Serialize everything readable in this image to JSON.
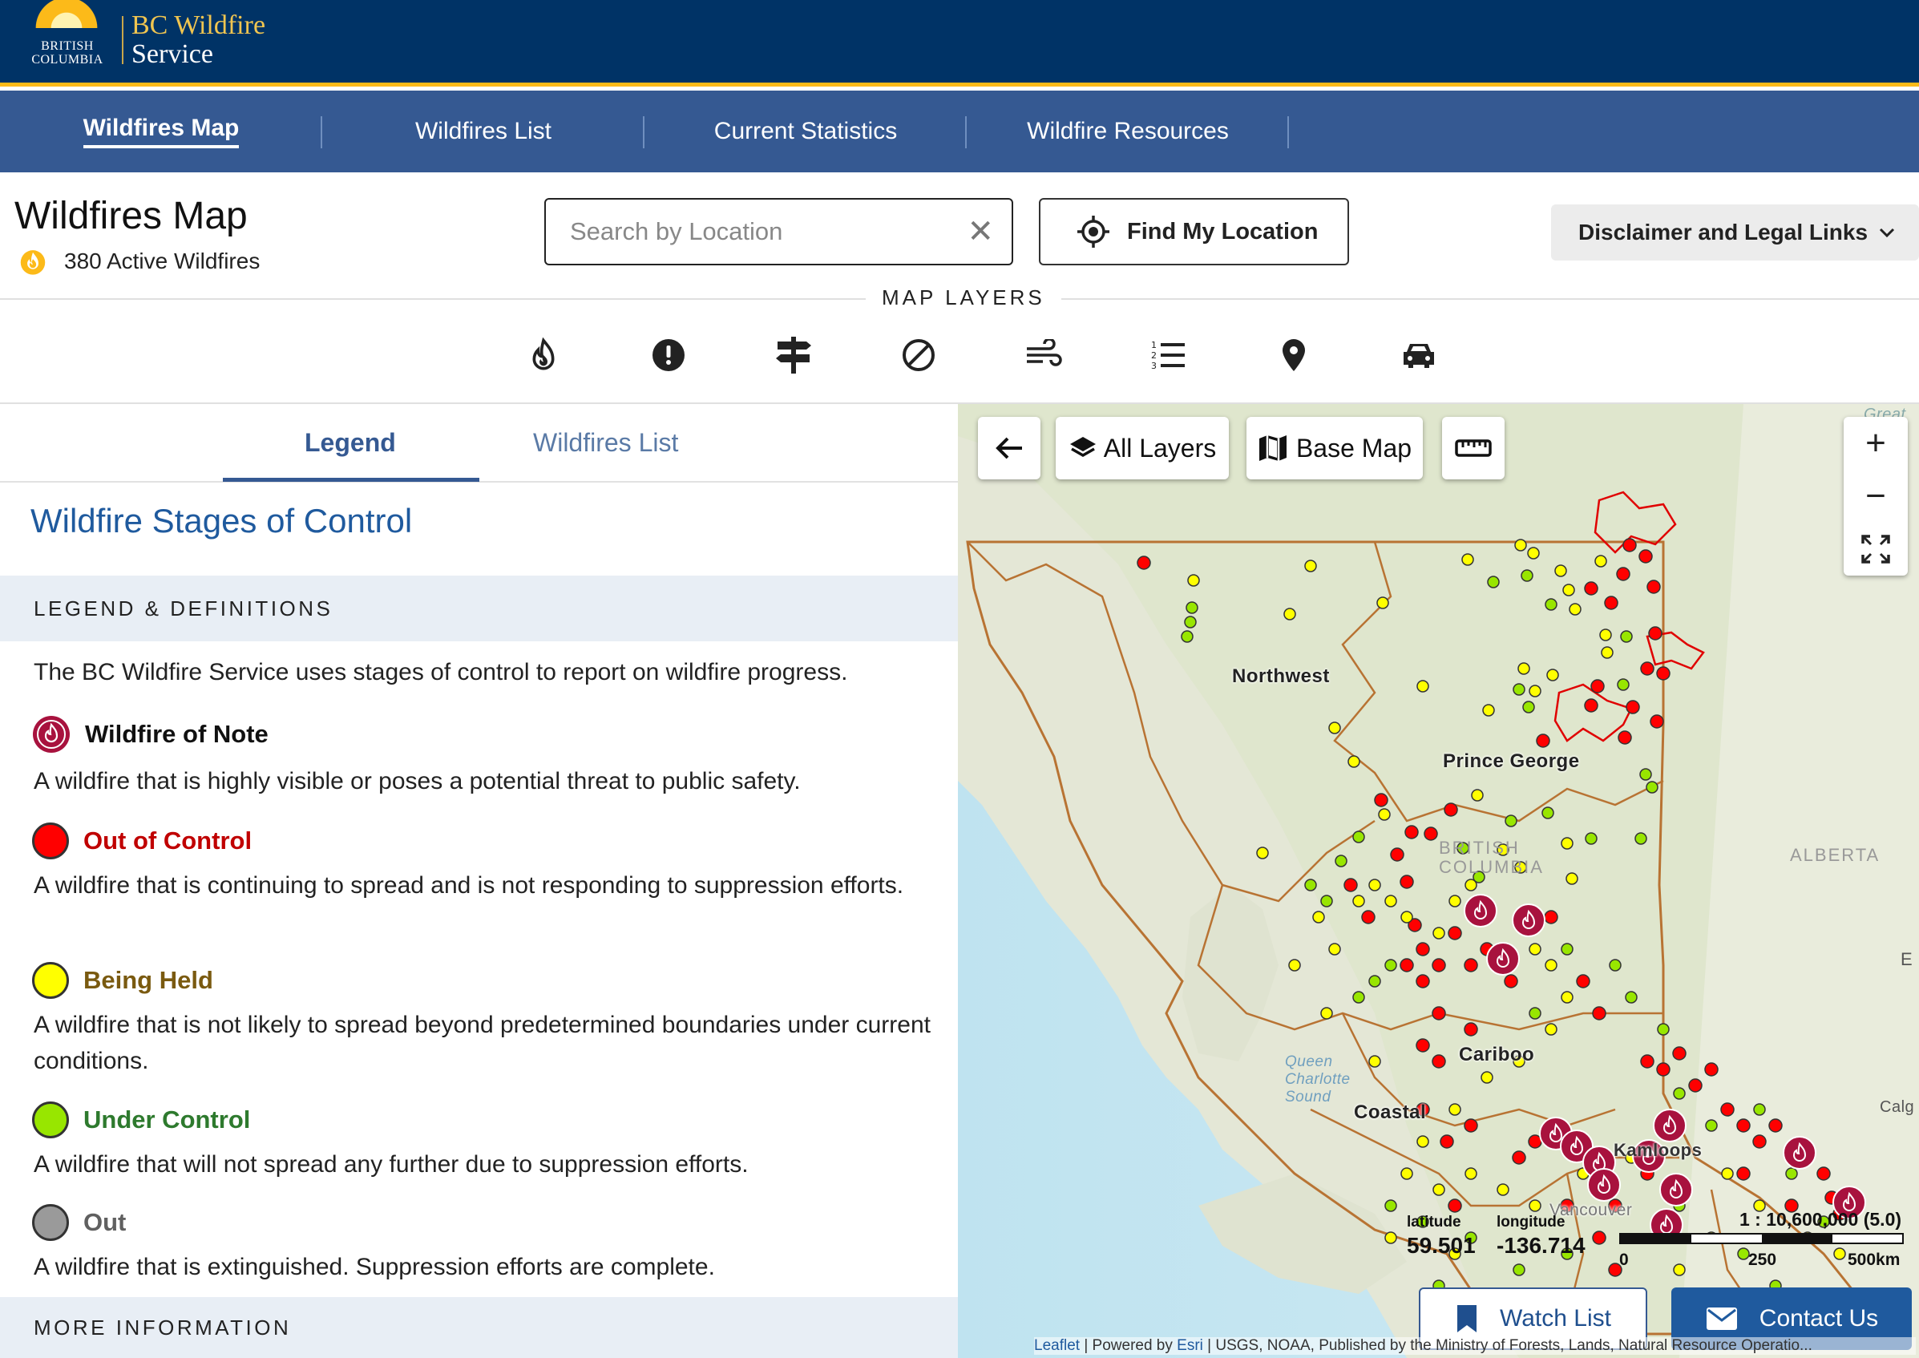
{
  "brand": {
    "province_line1": "BRITISH",
    "province_line2": "COLUMBIA",
    "service_line1": "BC Wildfire",
    "service_line2": "Service"
  },
  "nav": {
    "items": [
      {
        "label": "Wildfires Map",
        "active": true
      },
      {
        "label": "Wildfires List",
        "active": false
      },
      {
        "label": "Current Statistics",
        "active": false
      },
      {
        "label": "Wildfire Resources",
        "active": false
      }
    ]
  },
  "header": {
    "title": "Wildfires Map",
    "active_count": "380 Active Wildfires",
    "search_placeholder": "Search by Location",
    "clear_icon": "close-icon",
    "find_location_label": "Find My Location",
    "disclaimer_label": "Disclaimer and Legal Links",
    "map_layers_title": "MAP LAYERS",
    "layer_icons": [
      "flame-icon",
      "alert-icon",
      "signpost-icon",
      "ban-icon",
      "wind-icon",
      "list-icon",
      "pin-icon",
      "car-icon"
    ]
  },
  "panel": {
    "tabs": [
      {
        "label": "Legend",
        "active": true
      },
      {
        "label": "Wildfires List",
        "active": false
      }
    ],
    "section_title": "Wildfire Stages of Control",
    "definitions_heading": "LEGEND & DEFINITIONS",
    "intro": "The BC Wildfire Service uses stages of control to report on wildfire progress.",
    "stages": [
      {
        "title": "Wildfire of Note",
        "description": "A wildfire that is highly visible or poses a potential threat to public safety.",
        "color": "#a8123e",
        "text_color": "#111111"
      },
      {
        "title": "Out of Control",
        "description": "A wildfire that is continuing to spread and is not responding to suppression efforts.",
        "color": "#ff0000",
        "text_color": "#c00000"
      },
      {
        "title": "Being Held",
        "description": "A wildfire that is not likely to spread beyond predetermined boundaries under current conditions.",
        "color": "#ffff00",
        "text_color": "#7a5a10"
      },
      {
        "title": "Under Control",
        "description": "A wildfire that will not spread any further due to suppression efforts.",
        "color": "#98e600",
        "text_color": "#2e7a2e"
      },
      {
        "title": "Out",
        "description": "A wildfire that is extinguished. Suppression efforts are complete.",
        "color": "#9a9a9a",
        "text_color": "#606060"
      }
    ],
    "more_info_heading": "MORE INFORMATION"
  },
  "map": {
    "back_icon": "arrow-left-icon",
    "all_layers_label": "All Layers",
    "base_map_label": "Base Map",
    "measure_icon": "ruler-icon",
    "zoom_in": "+",
    "zoom_out": "−",
    "fullscreen_icon": "fullscreen-icon",
    "labels": {
      "northwest": "Northwest",
      "prince_george": "Prince George",
      "cariboo": "Cariboo",
      "coastal": "Coastal",
      "kamloops": "Kamloops",
      "vancouver": "Vancouver",
      "alberta": "ALBERTA",
      "british_columbia": "BRITISH COLUMBIA",
      "queen_charlotte": "Queen Charlotte Sound",
      "great": "Great",
      "calgary": "Calg",
      "e": "E"
    },
    "latitude_label": "latitude",
    "latitude_value": "59.501",
    "longitude_label": "longitude",
    "longitude_value": "-136.714",
    "scale_ratio": "1 : 10,600,000 (5.0)",
    "scale_ticks": [
      "0",
      "250",
      "500km"
    ],
    "watch_list_label": "Watch List",
    "contact_label": "Contact Us",
    "attribution_leaflet": "Leaflet",
    "attribution_text": " | Powered by ",
    "attribution_esri": "Esri",
    "attribution_rest": " | USGS, NOAA, Published by the Ministry of Forests, Lands, Natural Resource Operatio..."
  },
  "colors": {
    "banner": "#003366",
    "gold": "#fcba19",
    "nav": "#355992",
    "link": "#1f5a9e"
  }
}
